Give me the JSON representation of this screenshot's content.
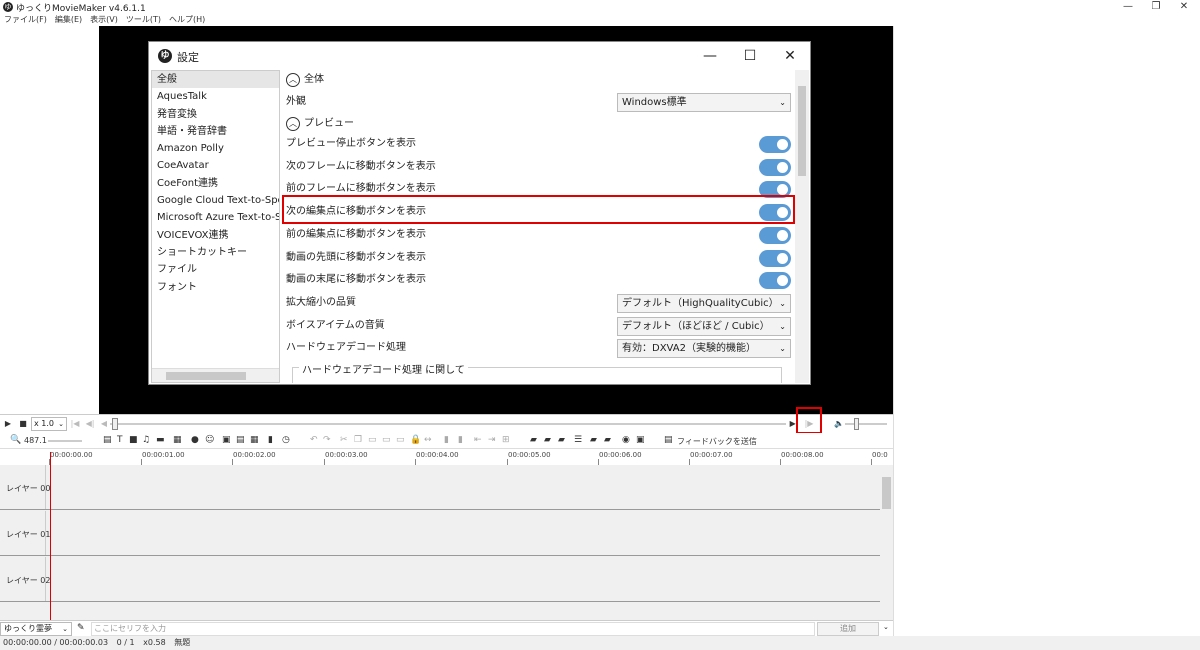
{
  "app": {
    "title": "ゆっくりMovieMaker v4.6.1.1",
    "icon_glyph": "ゆ"
  },
  "window_controls": {
    "minimize": "—",
    "maximize": "❐",
    "close": "✕"
  },
  "menu": [
    "ファイル(F)",
    "編集(E)",
    "表示(V)",
    "ツール(T)",
    "ヘルプ(H)"
  ],
  "dialog": {
    "title": "設定",
    "icon_glyph": "ゆ",
    "controls": {
      "minimize": "—",
      "maximize": "☐",
      "close": "✕"
    },
    "nav_items": [
      "全般",
      "AquesTalk",
      "発音変換",
      "単語・発音辞書",
      "Amazon Polly",
      "CoeAvatar",
      "CoeFont連携",
      "Google Cloud Text-to-Speech",
      "Microsoft Azure Text-to-Speech",
      "VOICEVOX連携",
      "ショートカットキー",
      "ファイル",
      "フォント"
    ],
    "selected_nav": "全般",
    "section_all": "全体",
    "appearance_label": "外観",
    "appearance_value": "Windows標準",
    "section_preview": "プレビュー",
    "toggles": [
      "プレビュー停止ボタンを表示",
      "次のフレームに移動ボタンを表示",
      "前のフレームに移動ボタンを表示",
      "次の編集点に移動ボタンを表示",
      "前の編集点に移動ボタンを表示",
      "動画の先頭に移動ボタンを表示",
      "動画の末尾に移動ボタンを表示"
    ],
    "selects": [
      {
        "label": "拡大縮小の品質",
        "value": "デフォルト（HighQualityCubic）"
      },
      {
        "label": "ボイスアイテムの音質",
        "value": "デフォルト（ほどほど / Cubic）"
      },
      {
        "label": "ハードウェアデコード処理",
        "value": "有効：DXVA2（実験的機能）"
      }
    ],
    "subgroup_label": "ハードウェアデコード処理 に関して"
  },
  "transport": {
    "speed": "x 1.0"
  },
  "toolbar": {
    "zoom": "487.1",
    "feedback": "フィードバックを送信"
  },
  "ruler": [
    "00:00:00.00",
    "00:00:01.00",
    "00:00:02.00",
    "00:00:03.00",
    "00:00:04.00",
    "00:00:05.00",
    "00:00:06.00",
    "00:00:07.00",
    "00:00:08.00",
    "00:0"
  ],
  "layers": [
    "レイヤー 00",
    "レイヤー 01",
    "レイヤー 02"
  ],
  "input": {
    "character": "ゆっくり霊夢",
    "placeholder": "ここにセリフを入力",
    "add": "追加"
  },
  "status": {
    "time": "00:00:00.00 / 00:00:00.03",
    "frame": "0 / 1",
    "zoom": "x0.58",
    "state": "無題"
  }
}
